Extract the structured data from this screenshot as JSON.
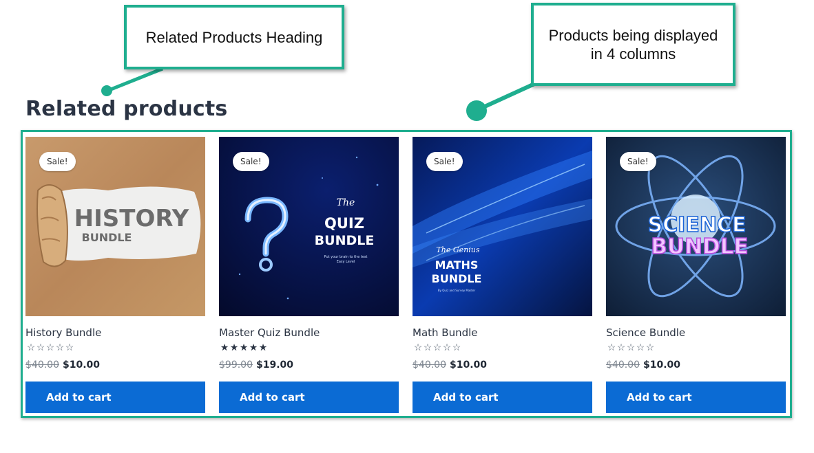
{
  "annotations": {
    "heading_callout": "Related Products Heading",
    "columns_callout": "Products being displayed in 4 columns"
  },
  "section_title": "Related products",
  "products": [
    {
      "badge": "Sale!",
      "image_text": [
        "HISTORY",
        "BUNDLE"
      ],
      "name": "History Bundle",
      "rating": 0,
      "old_price": "$40.00",
      "new_price": "$10.00",
      "button": "Add to cart"
    },
    {
      "badge": "Sale!",
      "image_text": [
        "The",
        "QUIZ",
        "BUNDLE",
        "Put your brain to the test",
        "Easy Level"
      ],
      "name": "Master Quiz Bundle",
      "rating": 5,
      "old_price": "$99.00",
      "new_price": "$19.00",
      "button": "Add to cart"
    },
    {
      "badge": "Sale!",
      "image_text": [
        "The Genius",
        "MATHS",
        "BUNDLE",
        "By Quiz and Survey Master"
      ],
      "name": "Math Bundle",
      "rating": 0,
      "old_price": "$40.00",
      "new_price": "$10.00",
      "button": "Add to cart"
    },
    {
      "badge": "Sale!",
      "image_text": [
        "SCIENCE",
        "BUNDLE"
      ],
      "name": "Science Bundle",
      "rating": 0,
      "old_price": "$40.00",
      "new_price": "$10.00",
      "button": "Add to cart"
    }
  ],
  "colors": {
    "accent": "#1fae8f",
    "button": "#0b6bd4",
    "heading": "#2b3444"
  },
  "icons": [
    "star-rating-icon",
    "question-mark-icon",
    "atom-icon"
  ]
}
